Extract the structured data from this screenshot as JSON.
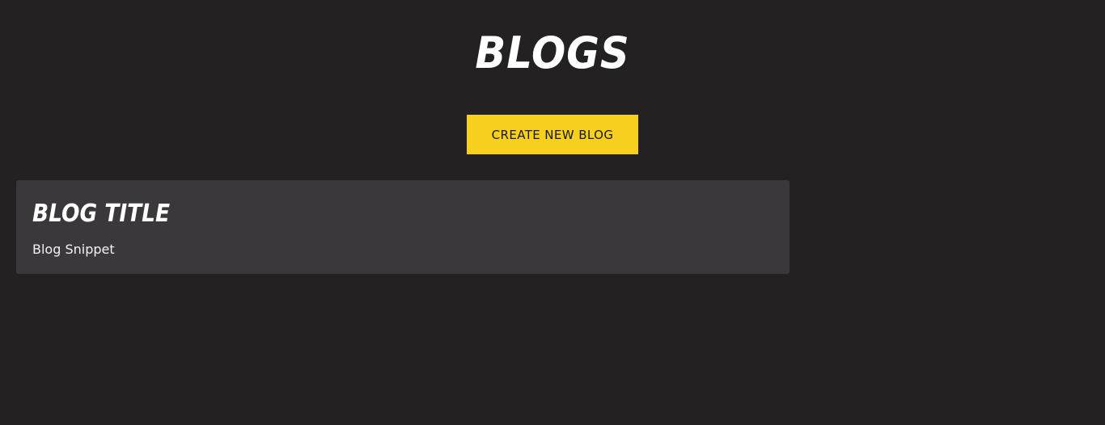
{
  "header": {
    "title": "BLOGS"
  },
  "actions": {
    "create_label": "CREATE NEW BLOG"
  },
  "blogs": [
    {
      "title": "BLOG TITLE",
      "snippet": "Blog Snippet"
    }
  ],
  "colors": {
    "background": "#232122",
    "card": "#3a383b",
    "accent": "#f7cf1f",
    "text": "#ffffff"
  }
}
